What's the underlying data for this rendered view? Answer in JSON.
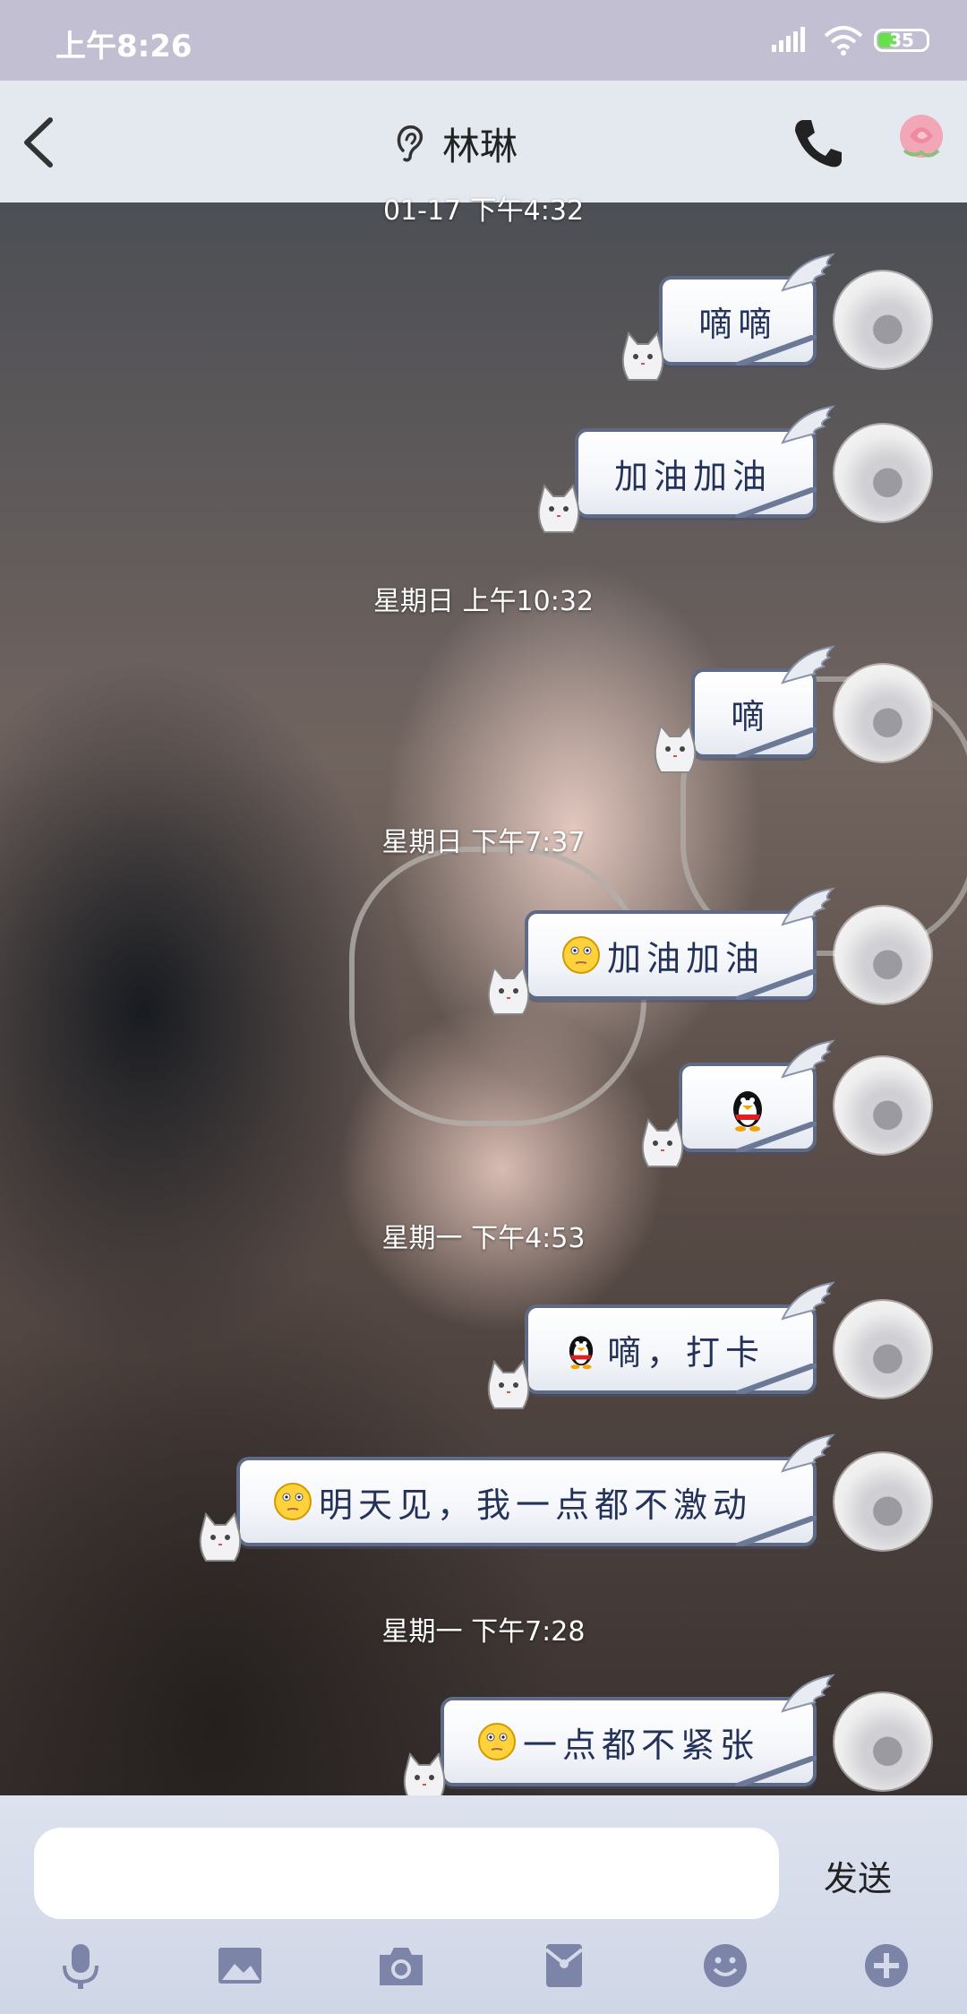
{
  "status_bar": {
    "time": "上午8:26",
    "battery": "35"
  },
  "header": {
    "title": "林琳"
  },
  "timestamps": {
    "cut_top": "01-17 下午4:32",
    "t1": "星期日 上午10:32",
    "t2": "星期日 下午7:37",
    "t3": "星期一 下午4:53",
    "t4": "星期一 下午7:28"
  },
  "messages": [
    {
      "text": "嘀嘀",
      "emoji": ""
    },
    {
      "text": "加油加油",
      "emoji": ""
    },
    {
      "text": "嘀",
      "emoji": ""
    },
    {
      "text": "加油加油",
      "emoji": "smiley-face-icon"
    },
    {
      "text": "",
      "emoji": "penguin-icon"
    },
    {
      "text": "嘀，打卡",
      "emoji": "penguin-icon"
    },
    {
      "text": "明天见，我一点都不激动",
      "emoji": "smiley-face-icon"
    },
    {
      "text": "一点都不紧张",
      "emoji": "smiley-face-icon"
    }
  ],
  "input_bar": {
    "placeholder": "",
    "send_label": "发送"
  },
  "toolbar": {
    "icons": [
      "microphone-icon",
      "image-icon",
      "camera-icon",
      "red-packet-icon",
      "emoji-icon",
      "plus-icon"
    ]
  },
  "colors": {
    "status_bar_bg": "#c2bfd2",
    "header_bg": "#eaeef6",
    "bubble_border": "#5f6b86",
    "bubble_text": "#24325a"
  }
}
